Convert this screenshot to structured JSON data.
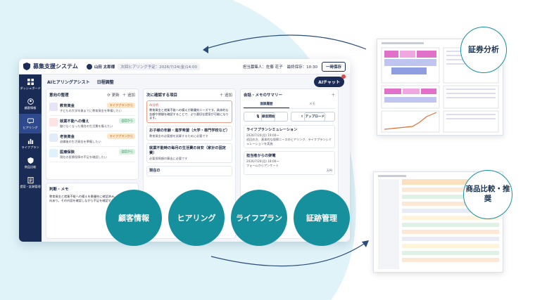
{
  "app": {
    "title": "募集支援システム",
    "user_name": "山田 太郎様",
    "next_hearing": "次回ヒアリング予定：2026/7/24(金)14:00",
    "agent_label": "担当募集人：佐藤 花子",
    "last_saved": "最終保存：10:30",
    "save_button": "一時保存"
  },
  "sidebar": {
    "items": [
      {
        "label": "ダッシュボード"
      },
      {
        "label": "顧客情報"
      },
      {
        "label": "ヒアリング"
      },
      {
        "label": "ライフプラン"
      },
      {
        "label": "商品比較"
      },
      {
        "label": "提案・証跡管理"
      }
    ]
  },
  "tabs": {
    "assist": "AIヒアリングアシスト",
    "schedule": "日程調整",
    "ai_chat": "AIチャット"
  },
  "intent": {
    "title": "意向の整理",
    "refresh": "更新",
    "add": "＋ 追加",
    "items": [
      {
        "title": "教育資金",
        "tag": "ライフプランから",
        "desc": "子どもの大学卒業までに教育資金を準備したい"
      },
      {
        "title": "就業不能への備え",
        "tag": "会話から",
        "desc": "働けなくなった場合の生活費を備えたい"
      },
      {
        "title": "老後資金",
        "tag": "ライフプランから",
        "desc": "退職後の生活資金を準備したい"
      },
      {
        "title": "医療保険",
        "tag": "会話から",
        "desc": "現在の医療保障の不足を確認したい"
      }
    ]
  },
  "confirm": {
    "title": "次に確認する項目",
    "add": "＋ 追加",
    "ai_head": "AI分析",
    "ai_body": "教育資金と就業不能への備えが最優先ニーズです。具体的な金額や期間を確認することで、より適切な提案が可能になります。",
    "cards": [
      {
        "title": "お子様の年齢・進学希望（大学・専門学校など）",
        "desc": "教育資金の必要額を試算するために必要です"
      },
      {
        "title": "就業不能時の毎月の生活費の目安（家計の固定費）",
        "desc": "必要保障額の算出に必要です"
      },
      {
        "title": "現在の",
        "desc": ""
      }
    ]
  },
  "summary": {
    "title": "会話・メモのサマリー",
    "seg_history": "面談履歴",
    "seg_memo": "メモ",
    "record": "録音開始",
    "upload": "アップロード",
    "cards": [
      {
        "title": "ライフプランシミュレーション",
        "date": "2026/7/20(月) 19:00〜",
        "desc": "初回の方、基本的な保障ニーズのヒアリング、ライフプランシミュレーションを実施"
      },
      {
        "title": "担当者からの架電",
        "date": "2026/7/20(月) 18:00〜",
        "desc": "フォームからアンケート"
      }
    ],
    "bottom_text": "万円"
  },
  "memo": {
    "title": "判断・メモ",
    "text": "教育資金と就業不能への備えを最優先に確認済み。老後資金は意向あり。その内容を確認しながら不足を確認する"
  },
  "circles": [
    "顧客情報",
    "ヒアリング",
    "ライフプラン",
    "証跡管理"
  ],
  "badges": {
    "top": "証券分析",
    "bottom": "商品比較・推奨"
  },
  "colors": {
    "navy": "#1a2b55",
    "teal": "#17909e",
    "light_cyan": "#dff3f8"
  }
}
